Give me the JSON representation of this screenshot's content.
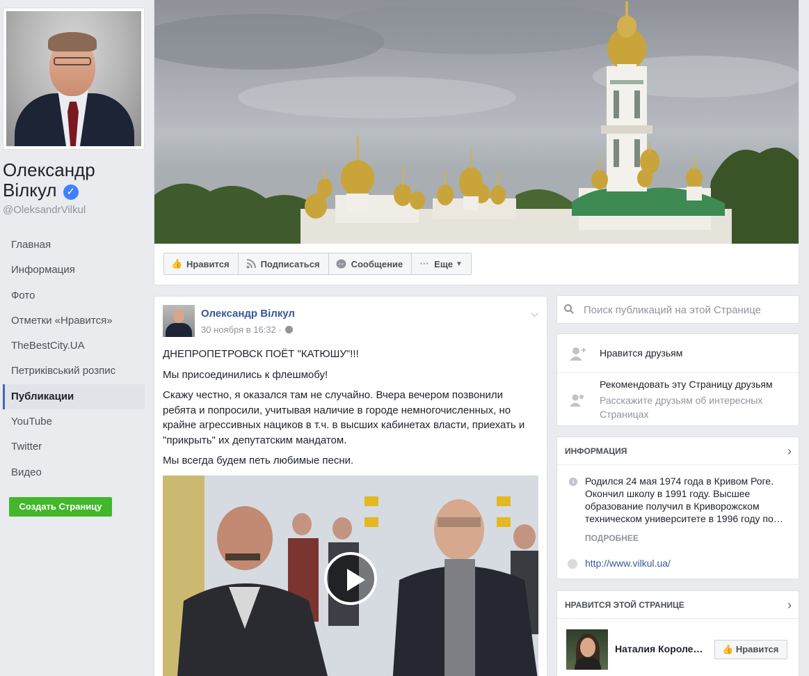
{
  "profile": {
    "name": "Олександр Вілкул",
    "handle": "@OleksandrVilkul"
  },
  "nav": {
    "items": [
      {
        "label": "Главная"
      },
      {
        "label": "Информация"
      },
      {
        "label": "Фото"
      },
      {
        "label": "Отметки «Нравится»"
      },
      {
        "label": "TheBestCity.UA"
      },
      {
        "label": "Петриківський розпис"
      },
      {
        "label": "Публикации",
        "active": true
      },
      {
        "label": "YouTube"
      },
      {
        "label": "Twitter"
      },
      {
        "label": "Видео"
      }
    ],
    "create_page": "Создать Страницу"
  },
  "actions": {
    "like": "Нравится",
    "subscribe": "Подписаться",
    "message": "Сообщение",
    "more": "Еще"
  },
  "post": {
    "author": "Олександр Вілкул",
    "date": "30 ноября в 16:32 ·",
    "paragraphs": [
      "ДНЕПРОПЕТРОВСК ПОЁТ \"КАТЮШУ\"!!!",
      "Мы присоединились к флешмобу!",
      "Скажу честно, я оказался там не случайно. Вчера вечером позвонили ребята и попросили, учитывая наличие в городе немногочисленных, но крайне агрессивных нациков в т.ч. в высших кабинетах власти, приехать и \"прикрыть\" их депутатским мандатом.",
      "Мы всегда будем петь любимые песни."
    ]
  },
  "search": {
    "placeholder": "Поиск публикаций на этой Странице"
  },
  "friends": {
    "liked_by_friends": "Нравится друзьям",
    "recommend": "Рекомендовать эту Страницу друзьям",
    "recommend_sub": "Расскажите друзьям об интересных Страницах"
  },
  "info": {
    "title": "ИНФОРМАЦИЯ",
    "bio": "Родился 24 мая 1974 года в Кривом Роге. Окончил школу в 1991 году. Высшее образование получил в Криворожском техническом университете в 1996 году по…",
    "more": "ПОДРОБНЕЕ",
    "url": "http://www.vilkul.ua/"
  },
  "page_likes": {
    "title": "НРАВИТСЯ ЭТОЙ СТРАНИЦЕ",
    "item_name": "Наталия Короле…",
    "like_button": "Нравится"
  },
  "colors": {
    "link": "#365899",
    "verified": "#4080ff",
    "create_button": "#42b72a",
    "background": "#e9ebee"
  }
}
